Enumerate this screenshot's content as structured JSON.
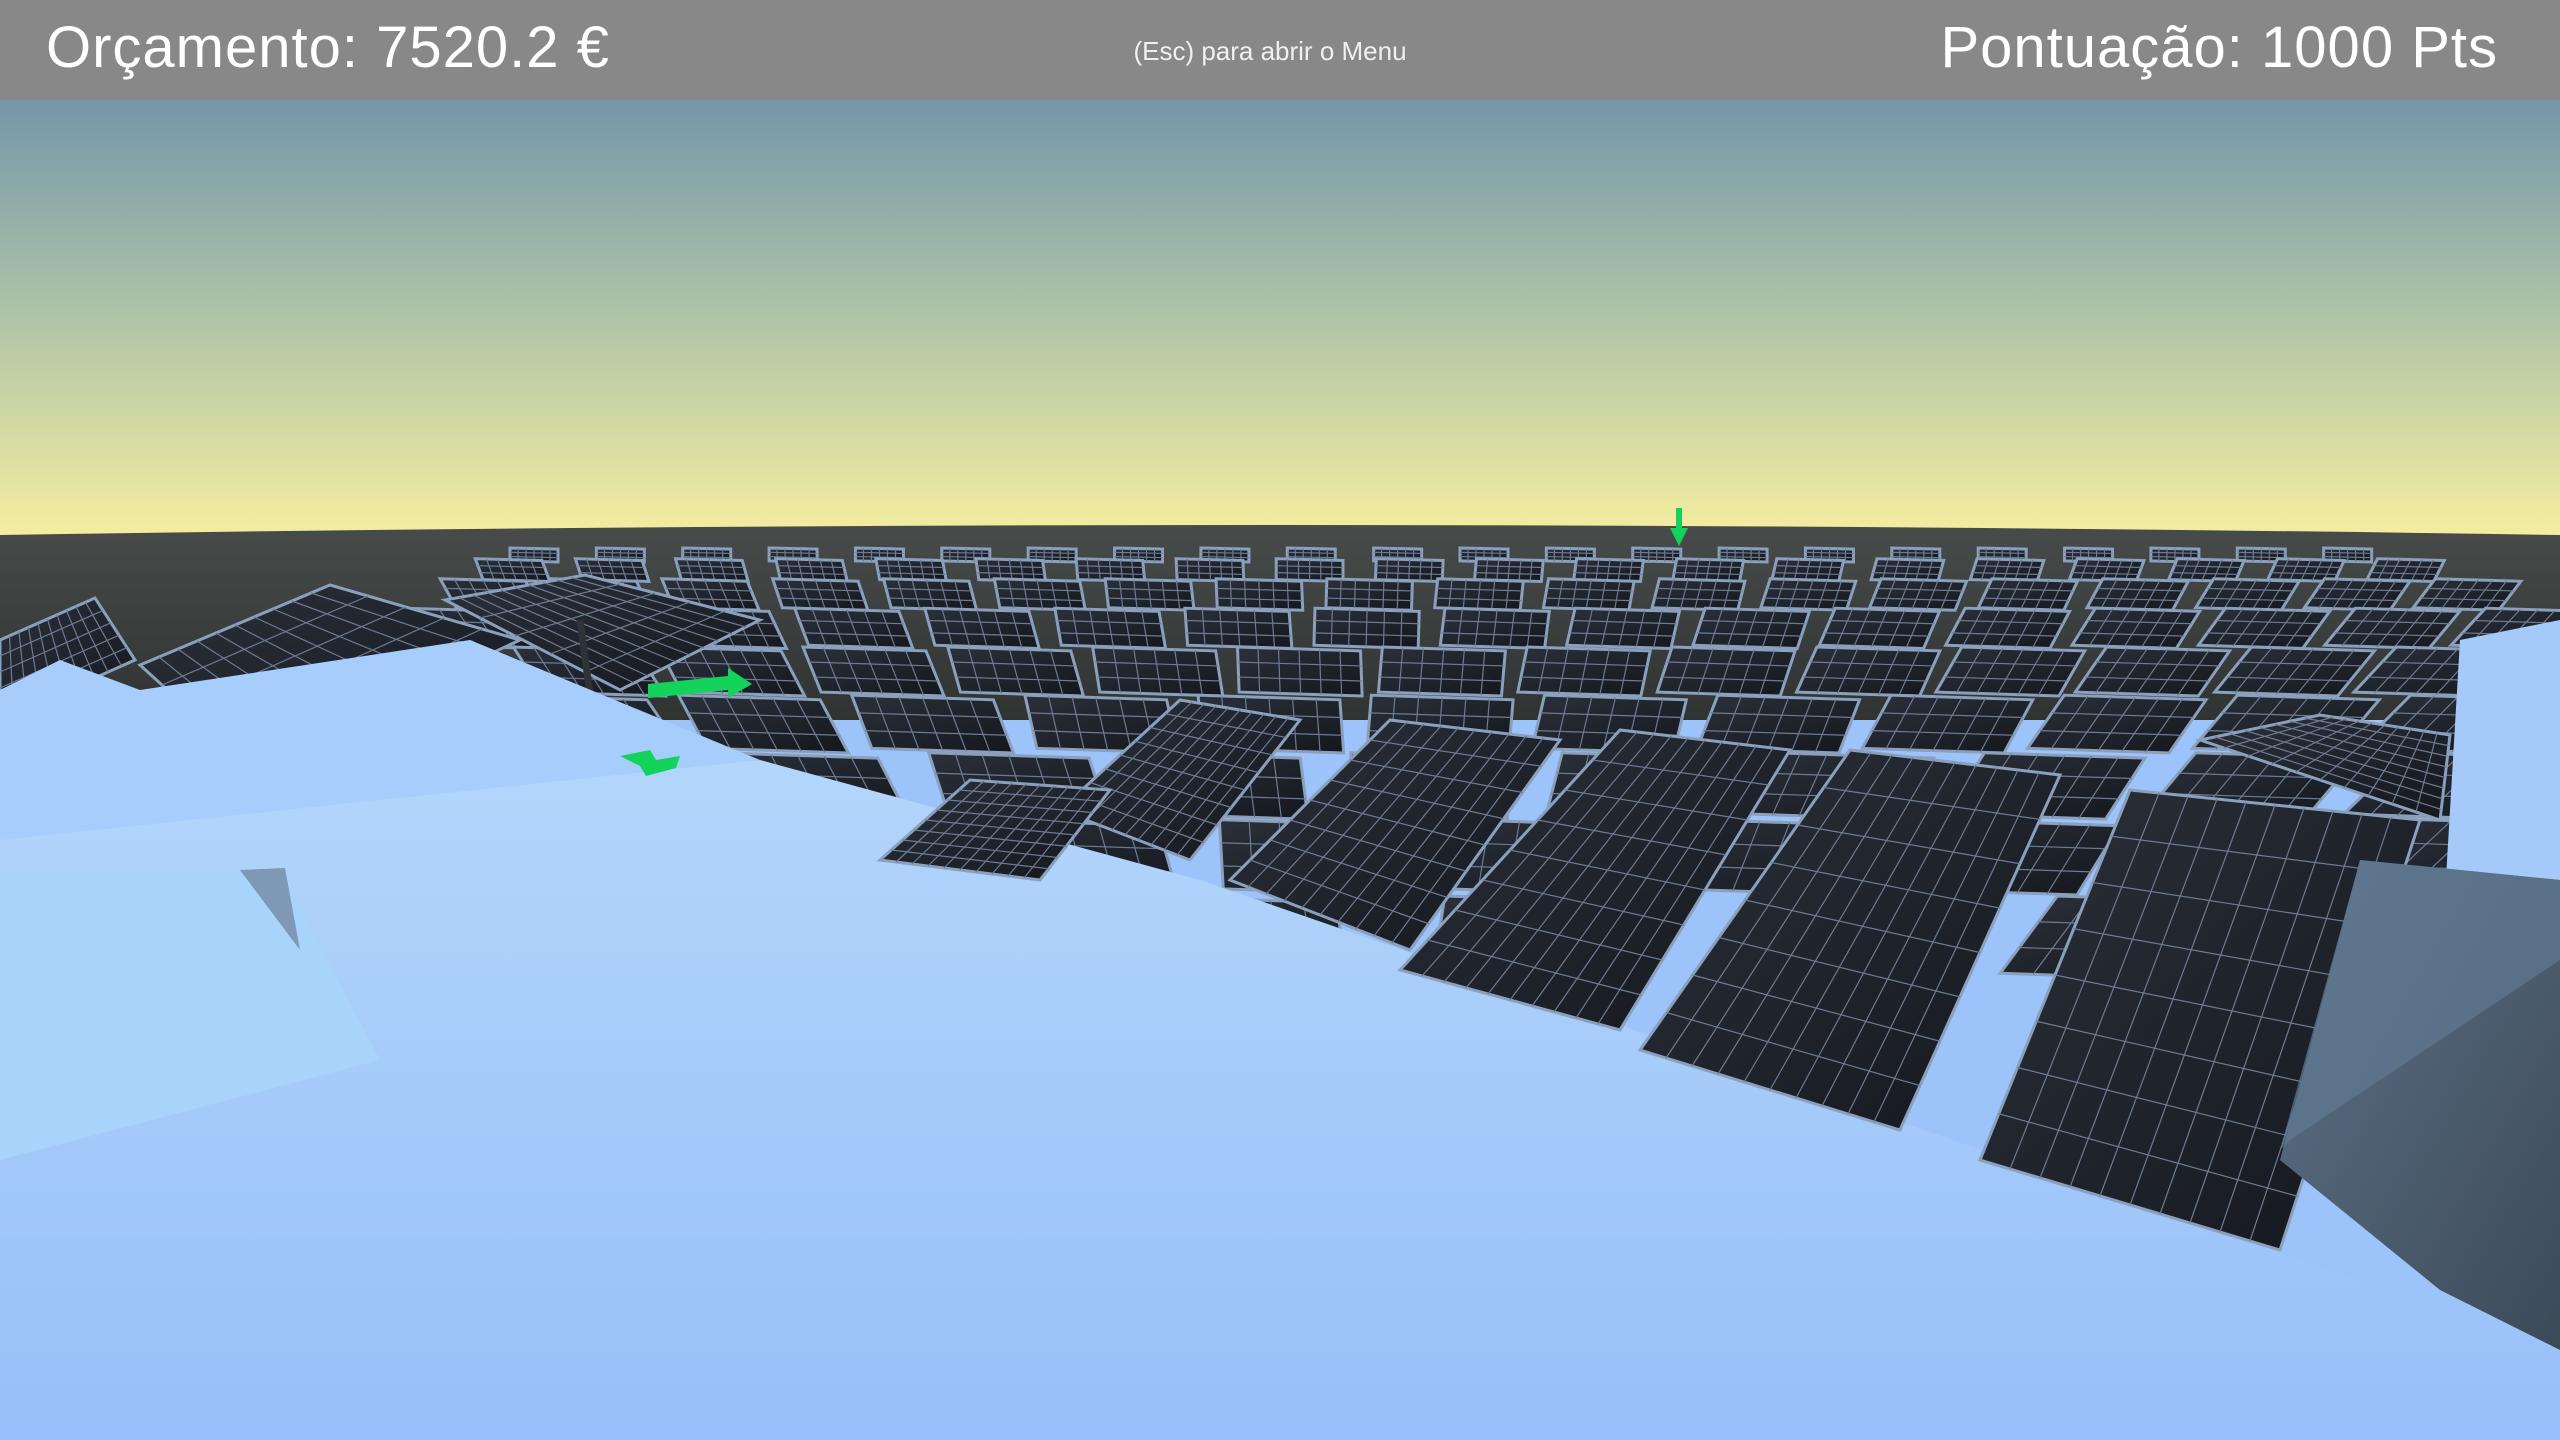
{
  "hud": {
    "budget_label": "Orçamento:",
    "budget_value": "7520.2 €",
    "menu_hint": "(Esc) para abrir o Menu",
    "score_label": "Pontuação:",
    "score_value": "1000 Pts"
  },
  "scene": {
    "description_icon": "solar-panel-field",
    "sky_top_color": "#7a9bb0",
    "sky_horizon_color": "#f6ee9f",
    "ground_color": "#3d4140",
    "roof_color": "#9dc4fa",
    "panel_color": "#1b1f27",
    "arrow_color": "#13d35a"
  }
}
